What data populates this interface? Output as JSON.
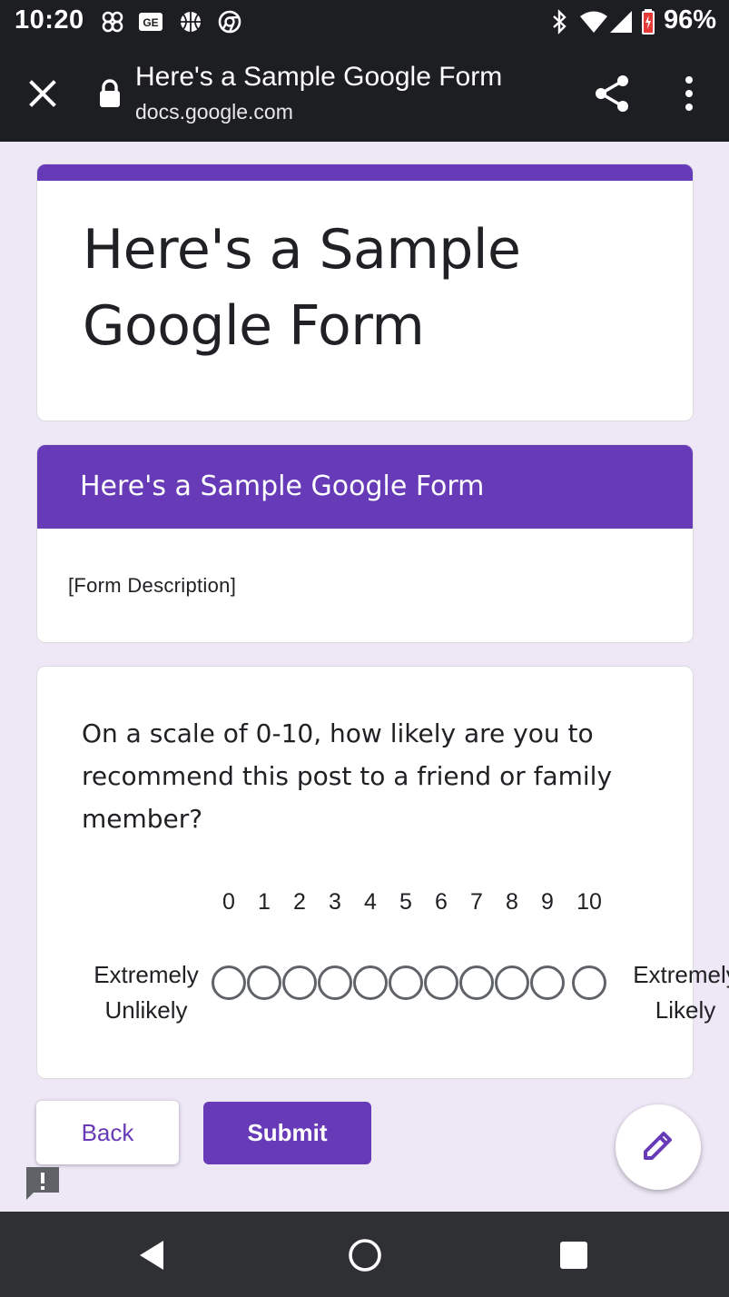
{
  "status_bar": {
    "time": "10:20",
    "battery": "96%"
  },
  "browser": {
    "title": "Here's a Sample Google Form",
    "url": "docs.google.com"
  },
  "form": {
    "title_line1": "Here's a Sample",
    "title_line2": "Google Form",
    "section_title": "Here's a Sample Google Form",
    "description": "[Form Description]",
    "question": "On a scale of 0-10, how likely are you to recommend this post to a friend or family member?",
    "scale_labels": [
      "0",
      "1",
      "2",
      "3",
      "4",
      "5",
      "6",
      "7",
      "8",
      "9",
      "10"
    ],
    "low_label_line1": "Extremely",
    "low_label_line2": "Unlikely",
    "high_label_line1": "Extremely",
    "high_label_line2": "Likely"
  },
  "buttons": {
    "back": "Back",
    "submit": "Submit"
  },
  "colors": {
    "accent": "#673ab7",
    "background": "#ede7f6",
    "system_bar": "#1d1e22"
  }
}
